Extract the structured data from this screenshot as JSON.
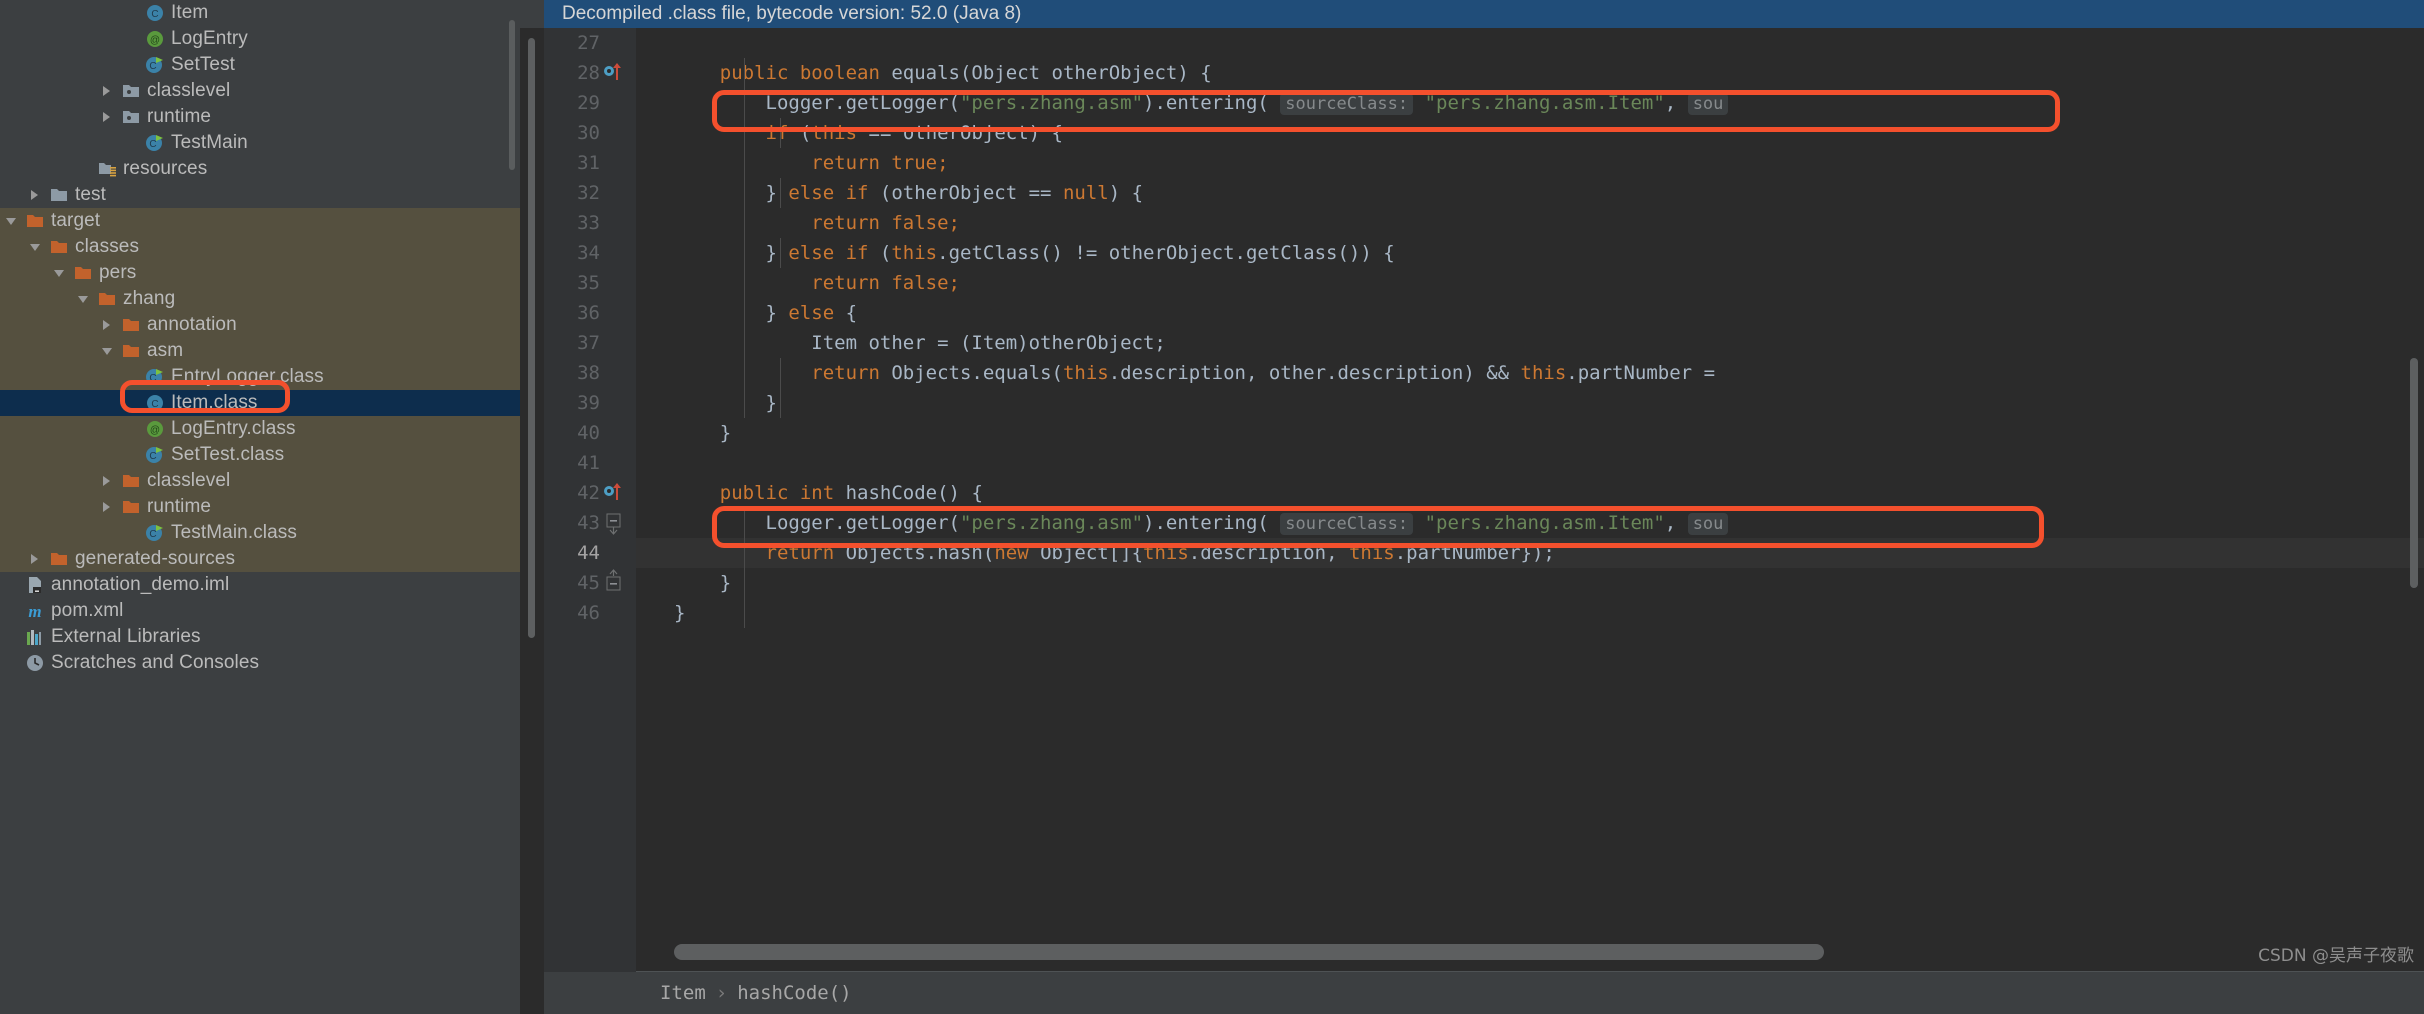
{
  "sidebar": {
    "rows": [
      {
        "indent": 5,
        "twisty": "none",
        "icon": "class-icon",
        "label": "Item",
        "bg": "normal"
      },
      {
        "indent": 5,
        "twisty": "none",
        "icon": "annotation-icon",
        "label": "LogEntry",
        "bg": "normal"
      },
      {
        "indent": 5,
        "twisty": "none",
        "icon": "class-run-icon",
        "label": "SetTest",
        "bg": "normal"
      },
      {
        "indent": 4,
        "twisty": "right",
        "icon": "package-folder-icon",
        "label": "classlevel",
        "bg": "normal"
      },
      {
        "indent": 4,
        "twisty": "right",
        "icon": "package-folder-icon",
        "label": "runtime",
        "bg": "normal"
      },
      {
        "indent": 5,
        "twisty": "none",
        "icon": "class-run-icon",
        "label": "TestMain",
        "bg": "normal"
      },
      {
        "indent": 3,
        "twisty": "none",
        "icon": "resources-folder-icon",
        "label": "resources",
        "bg": "normal"
      },
      {
        "indent": 1,
        "twisty": "right",
        "icon": "source-folder-icon",
        "label": "test",
        "bg": "normal"
      },
      {
        "indent": 0,
        "twisty": "down",
        "icon": "orange-folder-icon",
        "label": "target",
        "bg": "target"
      },
      {
        "indent": 1,
        "twisty": "down",
        "icon": "orange-folder-icon",
        "label": "classes",
        "bg": "target"
      },
      {
        "indent": 2,
        "twisty": "down",
        "icon": "orange-folder-icon",
        "label": "pers",
        "bg": "target"
      },
      {
        "indent": 3,
        "twisty": "down",
        "icon": "orange-folder-icon",
        "label": "zhang",
        "bg": "target"
      },
      {
        "indent": 4,
        "twisty": "right",
        "icon": "orange-folder-icon",
        "label": "annotation",
        "bg": "target"
      },
      {
        "indent": 4,
        "twisty": "down",
        "icon": "orange-folder-icon",
        "label": "asm",
        "bg": "target"
      },
      {
        "indent": 5,
        "twisty": "none",
        "icon": "class-run-icon",
        "label": "EntryLogger.class",
        "bg": "target"
      },
      {
        "indent": 5,
        "twisty": "none",
        "icon": "class-icon",
        "label": "Item.class",
        "bg": "selected"
      },
      {
        "indent": 5,
        "twisty": "none",
        "icon": "annotation-icon",
        "label": "LogEntry.class",
        "bg": "target"
      },
      {
        "indent": 5,
        "twisty": "none",
        "icon": "class-run-icon",
        "label": "SetTest.class",
        "bg": "target"
      },
      {
        "indent": 4,
        "twisty": "right",
        "icon": "orange-folder-icon",
        "label": "classlevel",
        "bg": "target"
      },
      {
        "indent": 4,
        "twisty": "right",
        "icon": "orange-folder-icon",
        "label": "runtime",
        "bg": "target"
      },
      {
        "indent": 5,
        "twisty": "none",
        "icon": "class-run-icon",
        "label": "TestMain.class",
        "bg": "target"
      },
      {
        "indent": 1,
        "twisty": "right",
        "icon": "orange-folder-icon",
        "label": "generated-sources",
        "bg": "target"
      },
      {
        "indent": 0,
        "twisty": "none",
        "icon": "iml-file-icon",
        "label": "annotation_demo.iml",
        "bg": "normal"
      },
      {
        "indent": 0,
        "twisty": "none",
        "icon": "maven-icon",
        "label": "pom.xml",
        "bg": "normal"
      },
      {
        "indent": 0,
        "twisty": "none",
        "icon": "libraries-icon",
        "label": "External Libraries",
        "bg": "normal"
      },
      {
        "indent": 0,
        "twisty": "none",
        "icon": "scratches-icon",
        "label": "Scratches and Consoles",
        "bg": "normal"
      }
    ]
  },
  "editor": {
    "notice": "Decompiled .class file, bytecode version: 52.0 (Java 8)",
    "lines": [
      {
        "num": "27",
        "gutter": "",
        "current": false,
        "tokens": [
          {
            "t": "",
            "c": ""
          }
        ]
      },
      {
        "num": "28",
        "gutter": "override-arrow",
        "current": false,
        "tokens": [
          {
            "t": "    ",
            "c": "txt"
          },
          {
            "t": "public boolean ",
            "c": "kw"
          },
          {
            "t": "equals(Object otherObject) {",
            "c": "txt"
          }
        ]
      },
      {
        "num": "29",
        "gutter": "",
        "current": false,
        "tokens": [
          {
            "t": "        Logger.getLogger(",
            "c": "txt"
          },
          {
            "t": "\"pers.zhang.asm\"",
            "c": "str"
          },
          {
            "t": ").entering( ",
            "c": "txt"
          },
          {
            "t": "sourceClass:",
            "c": "inlay"
          },
          {
            "t": " ",
            "c": "txt"
          },
          {
            "t": "\"pers.zhang.asm.Item\"",
            "c": "str"
          },
          {
            "t": ", ",
            "c": "txt"
          },
          {
            "t": "sou",
            "c": "inlay"
          }
        ]
      },
      {
        "num": "30",
        "gutter": "",
        "current": false,
        "tokens": [
          {
            "t": "        ",
            "c": "txt"
          },
          {
            "t": "if ",
            "c": "kw"
          },
          {
            "t": "(",
            "c": "txt"
          },
          {
            "t": "this ",
            "c": "kw"
          },
          {
            "t": "== otherObject) {",
            "c": "txt"
          }
        ]
      },
      {
        "num": "31",
        "gutter": "",
        "current": false,
        "tokens": [
          {
            "t": "            ",
            "c": "txt"
          },
          {
            "t": "return true;",
            "c": "kw"
          }
        ]
      },
      {
        "num": "32",
        "gutter": "",
        "current": false,
        "tokens": [
          {
            "t": "        } ",
            "c": "txt"
          },
          {
            "t": "else if ",
            "c": "kw"
          },
          {
            "t": "(otherObject == ",
            "c": "txt"
          },
          {
            "t": "null",
            "c": "kw"
          },
          {
            "t": ") {",
            "c": "txt"
          }
        ]
      },
      {
        "num": "33",
        "gutter": "",
        "current": false,
        "tokens": [
          {
            "t": "            ",
            "c": "txt"
          },
          {
            "t": "return false;",
            "c": "kw"
          }
        ]
      },
      {
        "num": "34",
        "gutter": "",
        "current": false,
        "tokens": [
          {
            "t": "        } ",
            "c": "txt"
          },
          {
            "t": "else if ",
            "c": "kw"
          },
          {
            "t": "(",
            "c": "txt"
          },
          {
            "t": "this",
            "c": "kw"
          },
          {
            "t": ".getClass() != otherObject.getClass()) {",
            "c": "txt"
          }
        ]
      },
      {
        "num": "35",
        "gutter": "",
        "current": false,
        "tokens": [
          {
            "t": "            ",
            "c": "txt"
          },
          {
            "t": "return false;",
            "c": "kw"
          }
        ]
      },
      {
        "num": "36",
        "gutter": "",
        "current": false,
        "tokens": [
          {
            "t": "        } ",
            "c": "txt"
          },
          {
            "t": "else ",
            "c": "kw"
          },
          {
            "t": "{",
            "c": "txt"
          }
        ]
      },
      {
        "num": "37",
        "gutter": "",
        "current": false,
        "tokens": [
          {
            "t": "            Item other = (Item)otherObject;",
            "c": "txt"
          }
        ]
      },
      {
        "num": "38",
        "gutter": "",
        "current": false,
        "tokens": [
          {
            "t": "            ",
            "c": "txt"
          },
          {
            "t": "return ",
            "c": "kw"
          },
          {
            "t": "Objects.equals(",
            "c": "txt"
          },
          {
            "t": "this",
            "c": "kw"
          },
          {
            "t": ".description, other.description) && ",
            "c": "txt"
          },
          {
            "t": "this",
            "c": "kw"
          },
          {
            "t": ".partNumber =",
            "c": "txt"
          }
        ]
      },
      {
        "num": "39",
        "gutter": "",
        "current": false,
        "tokens": [
          {
            "t": "        }",
            "c": "txt"
          }
        ]
      },
      {
        "num": "40",
        "gutter": "",
        "current": false,
        "tokens": [
          {
            "t": "    }",
            "c": "txt"
          }
        ]
      },
      {
        "num": "41",
        "gutter": "",
        "current": false,
        "tokens": [
          {
            "t": "",
            "c": "txt"
          }
        ]
      },
      {
        "num": "42",
        "gutter": "override-arrow",
        "current": false,
        "tokens": [
          {
            "t": "    ",
            "c": "txt"
          },
          {
            "t": "public int ",
            "c": "kw"
          },
          {
            "t": "hashCode() {",
            "c": "txt"
          }
        ]
      },
      {
        "num": "43",
        "gutter": "fold-minus",
        "current": false,
        "tokens": [
          {
            "t": "        Logger.getLogger(",
            "c": "txt"
          },
          {
            "t": "\"pers.zhang.asm\"",
            "c": "str"
          },
          {
            "t": ").entering( ",
            "c": "txt"
          },
          {
            "t": "sourceClass:",
            "c": "inlay"
          },
          {
            "t": " ",
            "c": "txt"
          },
          {
            "t": "\"pers.zhang.asm.Item\"",
            "c": "str"
          },
          {
            "t": ", ",
            "c": "txt"
          },
          {
            "t": "sou",
            "c": "inlay"
          }
        ]
      },
      {
        "num": "44",
        "gutter": "",
        "current": true,
        "tokens": [
          {
            "t": "        ",
            "c": "txt"
          },
          {
            "t": "return ",
            "c": "kw"
          },
          {
            "t": "Objects.hash(",
            "c": "txt"
          },
          {
            "t": "new ",
            "c": "kw"
          },
          {
            "t": "Object[]{",
            "c": "txt"
          },
          {
            "t": "this",
            "c": "kw"
          },
          {
            "t": ".description, ",
            "c": "txt"
          },
          {
            "t": "this",
            "c": "kw"
          },
          {
            "t": ".partNumber});",
            "c": "txt"
          }
        ]
      },
      {
        "num": "45",
        "gutter": "fold-end",
        "current": false,
        "tokens": [
          {
            "t": "    }",
            "c": "txt"
          }
        ]
      },
      {
        "num": "46",
        "gutter": "",
        "current": false,
        "tokens": [
          {
            "t": "}",
            "c": "txt"
          }
        ]
      }
    ],
    "breadcrumb": [
      "Item",
      "hashCode()"
    ],
    "breadcrumb_separator": "›"
  },
  "watermark": "CSDN @吴声子夜歌",
  "colors": {
    "annotation_red": "#f4502d",
    "selection_blue": "#0d2d4d",
    "target_bg": "#55503f",
    "notice_bg": "#204d79",
    "editor_bg": "#2b2b2b",
    "sidebar_bg": "#3c3f41",
    "keyword_orange": "#cc7832",
    "string_green": "#6a8759",
    "text_grey": "#a9b7c6"
  }
}
